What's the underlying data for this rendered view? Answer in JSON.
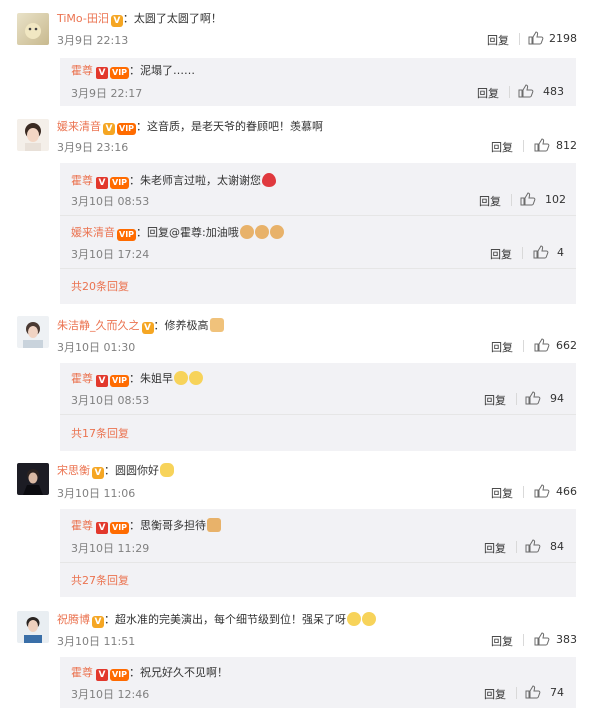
{
  "comments": [
    {
      "user": "TiMo-田汨",
      "text": "太圆了太圆了啊！",
      "time": "3月9日 22:13",
      "reply": "回复",
      "likes": "2198",
      "replies": [
        {
          "user": "霍尊",
          "text": "泥塌了……",
          "time": "3月9日 22:17",
          "reply": "回复",
          "likes": "483"
        }
      ]
    },
    {
      "user": "媛来清音",
      "text": "这音质，是老天爷的眷顾吧！羡慕啊",
      "time": "3月9日 23:16",
      "reply": "回复",
      "likes": "812",
      "replies": [
        {
          "user": "霍尊",
          "text": "朱老师言过啦，太谢谢您",
          "time": "3月10日 08:53",
          "reply": "回复",
          "likes": "102"
        },
        {
          "user": "媛来清音",
          "text": "回复@霍尊:加油哦",
          "time": "3月10日 17:24",
          "reply": "回复",
          "likes": "4"
        }
      ],
      "more": "共20条回复"
    },
    {
      "user": "朱洁静_久而久之",
      "text": "修养极高",
      "time": "3月10日 01:30",
      "reply": "回复",
      "likes": "662",
      "replies": [
        {
          "user": "霍尊",
          "text": "朱姐早",
          "time": "3月10日 08:53",
          "reply": "回复",
          "likes": "94"
        }
      ],
      "more": "共17条回复"
    },
    {
      "user": "宋思衡",
      "text": "圆圆你好",
      "time": "3月10日 11:06",
      "reply": "回复",
      "likes": "466",
      "replies": [
        {
          "user": "霍尊",
          "text": "思衡哥多担待",
          "time": "3月10日 11:29",
          "reply": "回复",
          "likes": "84"
        }
      ],
      "more": "共27条回复"
    },
    {
      "user": "祝腾博",
      "text": "超水准的完美演出，每个细节级到位！强呆了呀",
      "time": "3月10日 11:51",
      "reply": "回复",
      "likes": "383",
      "replies": [
        {
          "user": "霍尊",
          "text": "祝兄好久不见啊！",
          "time": "3月10日 12:46",
          "reply": "回复",
          "likes": "74"
        }
      ]
    }
  ],
  "colors": {
    "name": "#eb7350",
    "time": "#808080",
    "sub_bg": "#f2f2f5"
  },
  "icons": {
    "like": "thumbs-up-icon",
    "verified": "v-badge-icon",
    "vip": "vip-badge-icon"
  }
}
